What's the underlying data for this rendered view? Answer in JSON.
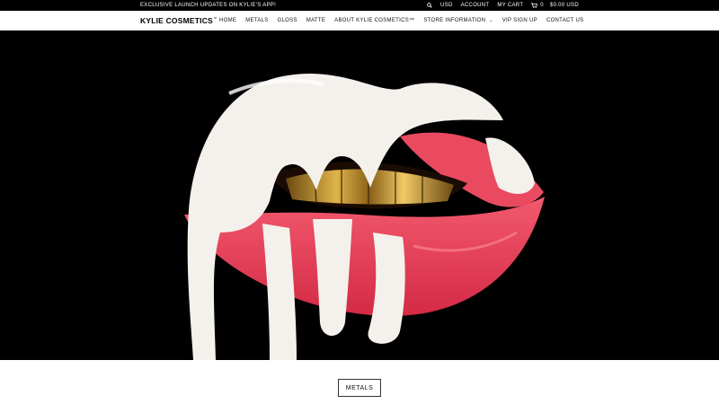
{
  "topbar": {
    "promo": "EXCLUSIVE LAUNCH UPDATES ON KYLIE'S APP!",
    "currency": "USD",
    "account": "ACCOUNT",
    "cart": "MY CART",
    "cart_count": "0",
    "cart_total": "$0.00 USD"
  },
  "header": {
    "logo": "KYLIE COSMETICS",
    "logo_mark": "™",
    "nav": [
      "HOME",
      "METALS",
      "GLOSS",
      "MATTE",
      "ABOUT KYLIE COSMETICS™",
      "STORE INFORMATION",
      "VIP SIGN UP",
      "CONTACT US"
    ]
  },
  "hero": {
    "background": "#000000",
    "lip_color": "#e8364f",
    "drip_color": "#f4f1ec",
    "teeth_color": "#c8962e"
  },
  "section": {
    "button_label": "METALS"
  }
}
